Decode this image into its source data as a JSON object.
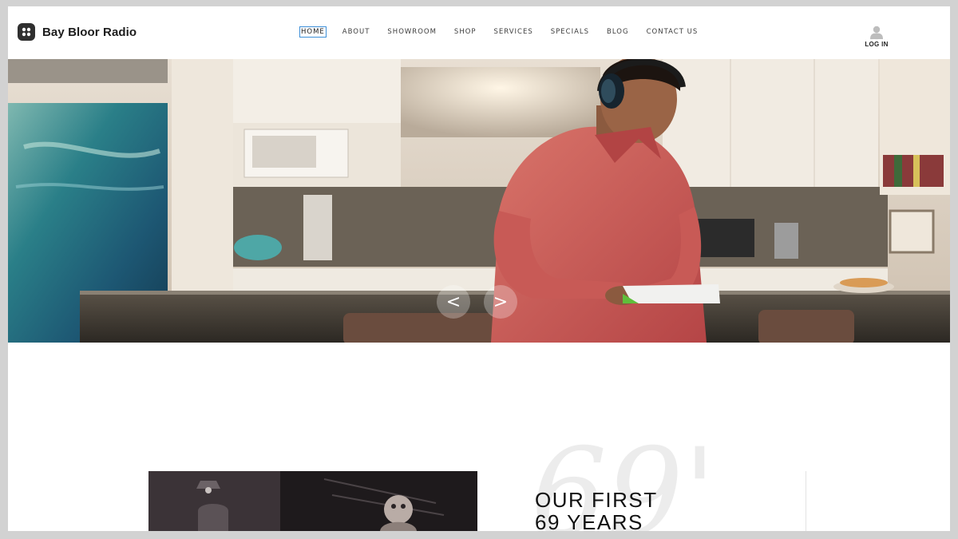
{
  "brand": {
    "name": "Bay Bloor Radio"
  },
  "nav": {
    "items": [
      "HOME",
      "ABOUT",
      "SHOWROOM",
      "SHOP",
      "SERVICES",
      "SPECIALS",
      "BLOG",
      "CONTACT US"
    ],
    "active": "HOME"
  },
  "account": {
    "login_label": "LOG IN"
  },
  "hero": {
    "prev_label": "<",
    "next_label": ">"
  },
  "history": {
    "title_line1": "OUR FIRST",
    "title_line2": "69 YEARS",
    "background_numeral": "69'"
  },
  "colors": {
    "active_outline": "#3d8fd8",
    "hero_shirt": "#c9504f"
  }
}
